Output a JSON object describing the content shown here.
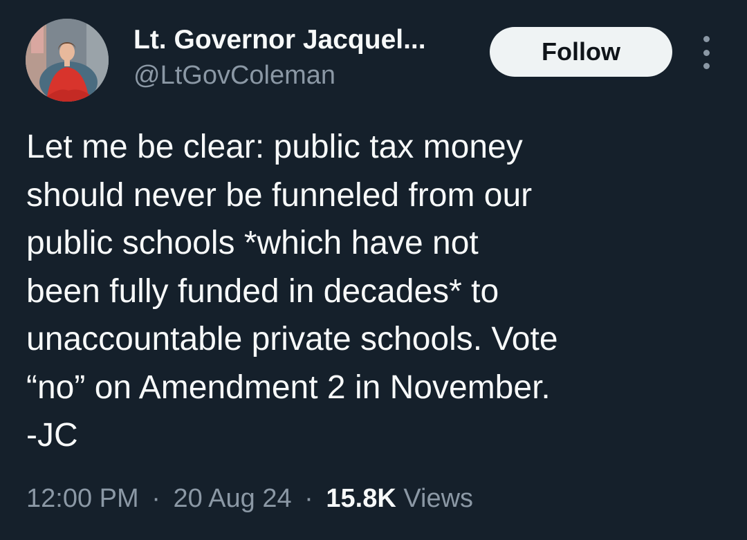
{
  "author": {
    "display_name": "Lt. Governor Jacquel...",
    "handle": "@LtGovColeman"
  },
  "actions": {
    "follow_label": "Follow",
    "more_icon": "more-vertical-icon"
  },
  "tweet": {
    "lines": [
      "Let me be clear: public tax money",
      "should never be funneled from our",
      "public schools *which have not",
      "been fully funded in decades* to",
      "unaccountable private schools. Vote",
      "“no” on Amendment 2 in November.",
      "-JC"
    ]
  },
  "meta": {
    "time": "12:00 PM",
    "separator": "·",
    "date": "20 Aug 24",
    "views_count": "15.8K",
    "views_label": "Views"
  },
  "colors": {
    "background": "#15202b",
    "text_primary": "#f7f9f9",
    "text_secondary": "#8b98a5",
    "follow_button_bg": "#eff3f4"
  }
}
